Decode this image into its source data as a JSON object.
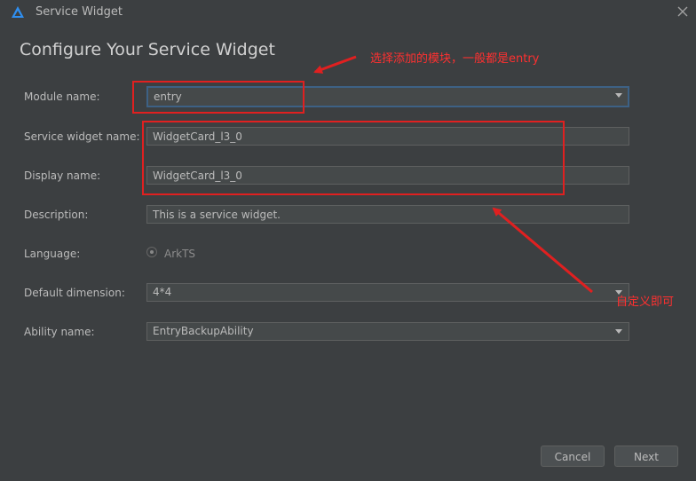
{
  "window": {
    "title": "Service Widget",
    "close_label": "×"
  },
  "heading": "Configure Your Service Widget",
  "form": {
    "module_name": {
      "label": "Module name:",
      "value": "entry"
    },
    "service_widget_name": {
      "label": "Service widget name:",
      "value": "WidgetCard_l3_0"
    },
    "display_name": {
      "label": "Display name:",
      "value": "WidgetCard_l3_0"
    },
    "description": {
      "label": "Description:",
      "value": "This is a service widget."
    },
    "language": {
      "label": "Language:",
      "value": "ArkTS"
    },
    "default_dimension": {
      "label": "Default dimension:",
      "value": "4*4"
    },
    "ability_name": {
      "label": "Ability name:",
      "value": "EntryBackupAbility"
    }
  },
  "buttons": {
    "cancel": "Cancel",
    "next": "Next"
  },
  "annotations": {
    "module_note": "选择添加的模块，一般都是entry",
    "custom_note": "自定义即可"
  },
  "colors": {
    "annotation": "#e02020",
    "focus_border": "#3d6185",
    "background": "#3c3f41"
  }
}
